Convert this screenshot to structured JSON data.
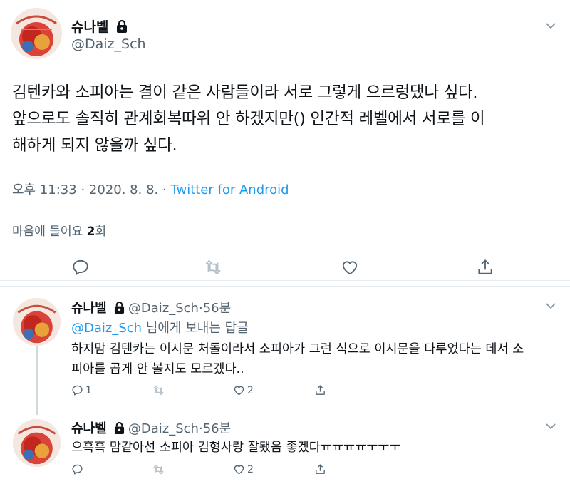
{
  "main_tweet": {
    "display_name": "슈나벨",
    "handle": "@Daiz_Sch",
    "text_lines": [
      "김텐카와 소피아는 결이 같은 사람들이라 서로 그렇게 으르렁댔나 싶다.",
      "앞으로도 솔직히 관계회복따위 안 하겠지만() 인간적 레벨에서 서로를 이",
      "해하게 되지 않을까 싶다."
    ],
    "time": "오후 11:33",
    "date": "2020. 8. 8.",
    "separator": "·",
    "source": "Twitter for Android",
    "likes_prefix": "마음에 들어요 ",
    "likes_count": "2",
    "likes_suffix": "회"
  },
  "replies": [
    {
      "display_name": "슈나벨",
      "handle": "@Daiz_Sch",
      "time_sep": "·",
      "time": "56분",
      "replying_mention": "@Daiz_Sch",
      "replying_suffix": " 님에게 보내는 답글",
      "text_lines": [
        "하지맘 김텐카는 이시문 처돌이라서 소피아가 그런 식으로 이시문을 다루었다는 데서 소",
        "피아를 곱게 안 볼지도 모르겠다.."
      ],
      "reply_count": "1",
      "retweet_count": "",
      "like_count": "2"
    },
    {
      "display_name": "슈나벨",
      "handle": "@Daiz_Sch",
      "time_sep": "·",
      "time": "56분",
      "text_lines": [
        "으흑흑 맘같아선 소피아 김형사랑 잘됐음 좋겠다ㅠㅠㅠㅠㅜㅜㅜ"
      ],
      "reply_count": "",
      "retweet_count": "",
      "like_count": "2"
    }
  ],
  "icons": {
    "lock": "lock-icon",
    "caret": "chevron-down-icon",
    "reply": "reply-icon",
    "retweet": "retweet-icon",
    "like": "heart-icon",
    "share": "share-icon"
  },
  "colors": {
    "link": "#1d9bf0",
    "muted": "#536471",
    "text": "#0f1419",
    "divider": "#e6ecf0"
  }
}
